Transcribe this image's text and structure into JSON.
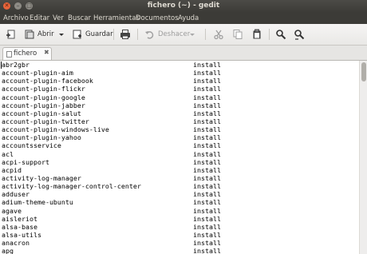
{
  "window": {
    "title": "fichero (~) - gedit"
  },
  "menu": [
    "Archivo",
    "Editar",
    "Ver",
    "Buscar",
    "Herramientas",
    "Documentos",
    "Ayuda"
  ],
  "toolbar": {
    "open_label": "Abrir",
    "save_label": "Guardar",
    "undo_label": "Deshacer"
  },
  "tab": {
    "label": "fichero",
    "close": "✖"
  },
  "lines": [
    [
      "abr2gbr",
      "install"
    ],
    [
      "account-plugin-aim",
      "install"
    ],
    [
      "account-plugin-facebook",
      "install"
    ],
    [
      "account-plugin-flickr",
      "install"
    ],
    [
      "account-plugin-google",
      "install"
    ],
    [
      "account-plugin-jabber",
      "install"
    ],
    [
      "account-plugin-salut",
      "install"
    ],
    [
      "account-plugin-twitter",
      "install"
    ],
    [
      "account-plugin-windows-live",
      "install"
    ],
    [
      "account-plugin-yahoo",
      "install"
    ],
    [
      "accountsservice",
      "install"
    ],
    [
      "acl",
      "install"
    ],
    [
      "acpi-support",
      "install"
    ],
    [
      "acpid",
      "install"
    ],
    [
      "activity-log-manager",
      "install"
    ],
    [
      "activity-log-manager-control-center",
      "install"
    ],
    [
      "adduser",
      "install"
    ],
    [
      "adium-theme-ubuntu",
      "install"
    ],
    [
      "agave",
      "install"
    ],
    [
      "aisleriot",
      "install"
    ],
    [
      "alsa-base",
      "install"
    ],
    [
      "alsa-utils",
      "install"
    ],
    [
      "anacron",
      "install"
    ],
    [
      "apg",
      "install"
    ]
  ],
  "colors": {
    "titlebar": "#3c3b37",
    "close_button": "#e9643a",
    "editor_bg": "#ffffff"
  }
}
